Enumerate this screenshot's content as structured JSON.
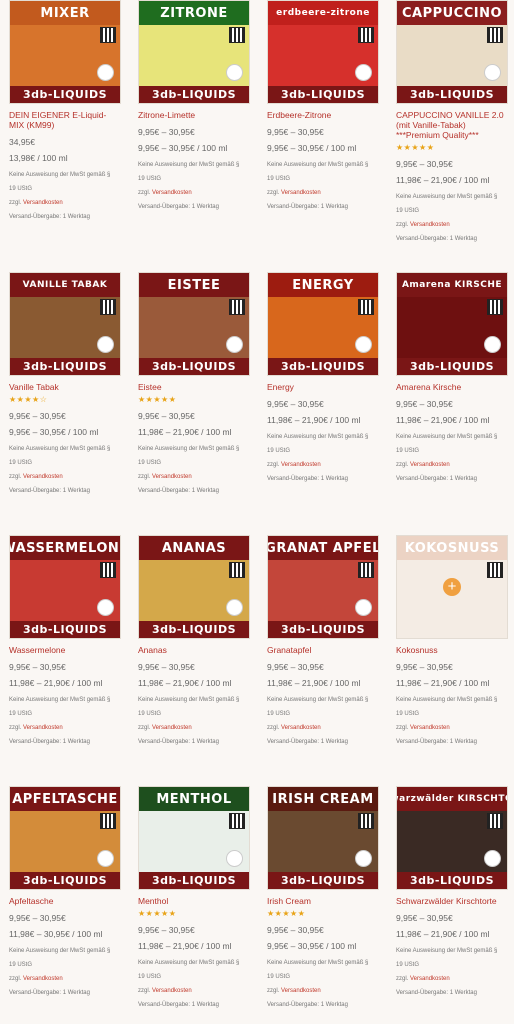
{
  "common": {
    "tax_line1": "Keine Ausweisung der MwSt gemäß §",
    "tax_line2": "19 UStG",
    "ship_prefix": "zzgl.",
    "ship_link": "Versandkosten",
    "handover": "Versand-Übergabe: 1 Werktag",
    "brand": "3db-LIQUIDS"
  },
  "colors": {
    "title": "#b5312a",
    "stars": "#e8a317",
    "brand_bar": "#7a1616"
  },
  "products": [
    {
      "title": "DEIN EIGENER E-Liquid-MIX (KM99)",
      "banner": "MIXER",
      "bg": "#d7742c",
      "banner_bg": "#c25a1e",
      "stars": "",
      "price": "34,95€",
      "unit": "13,98€ / 100 ml"
    },
    {
      "title": "Zitrone-Limette",
      "banner": "ZITRONE",
      "bg": "#e7e47a",
      "banner_bg": "#1f6d1f",
      "stars": "",
      "price": "9,95€ – 30,95€",
      "unit": "9,95€ – 30,95€ / 100 ml"
    },
    {
      "title": "Erdbeere-Zitrone",
      "banner": "erdbeere-zitrone",
      "bg": "#d6302c",
      "banner_bg": "#c0201c",
      "stars": "",
      "price": "9,95€ – 30,95€",
      "unit": "9,95€ – 30,95€ / 100 ml"
    },
    {
      "title": "CAPPUCCINO VANILLE 2.0 (mit Vanille-Tabak) ***Premium Quality***",
      "banner": "CAPPUCCINO",
      "bg": "#e9dcc6",
      "banner_bg": "#8b1e1e",
      "stars": "★★★★★",
      "price": "9,95€ – 30,95€",
      "unit": "11,98€ – 21,90€ / 100 ml"
    },
    {
      "title": "Vanille Tabak",
      "banner": "VANILLE TABAK",
      "bg": "#8a5a32",
      "banner_bg": "#7a1616",
      "stars": "★★★★☆",
      "price": "9,95€ – 30,95€",
      "unit": "9,95€ – 30,95€ / 100 ml"
    },
    {
      "title": "Eistee",
      "banner": "EISTEE",
      "bg": "#9a5a3a",
      "banner_bg": "#7a1616",
      "stars": "★★★★★",
      "price": "9,95€ – 30,95€",
      "unit": "11,98€ – 21,90€ / 100 ml"
    },
    {
      "title": "Energy",
      "banner": "ENERGY",
      "bg": "#d8671c",
      "banner_bg": "#9d1c10",
      "stars": "",
      "price": "9,95€ – 30,95€",
      "unit": "11,98€ – 21,90€ / 100 ml"
    },
    {
      "title": "Amarena Kirsche",
      "banner": "Amarena KIRSCHE",
      "bg": "#6e1010",
      "banner_bg": "#7a1616",
      "stars": "",
      "price": "9,95€ – 30,95€",
      "unit": "11,98€ – 21,90€ / 100 ml"
    },
    {
      "title": "Wassermelone",
      "banner": "WASSERMELONE",
      "bg": "#c83a32",
      "banner_bg": "#7a1616",
      "stars": "",
      "price": "9,95€ – 30,95€",
      "unit": "11,98€ – 21,90€ / 100 ml"
    },
    {
      "title": "Ananas",
      "banner": "ANANAS",
      "bg": "#d4a84a",
      "banner_bg": "#7a1616",
      "stars": "",
      "price": "9,95€ – 30,95€",
      "unit": "11,98€ – 21,90€ / 100 ml"
    },
    {
      "title": "Granatapfel",
      "banner": "GRANAT APFEL",
      "bg": "#c3463a",
      "banner_bg": "#7a1616",
      "stars": "",
      "price": "9,95€ – 30,95€",
      "unit": "11,98€ – 21,90€ / 100 ml"
    },
    {
      "title": "Kokosnuss",
      "banner": "KOKOSNUSS",
      "bg": "#f4ece4",
      "banner_bg": "#ecd3c4",
      "stars": "",
      "price": "9,95€ – 30,95€",
      "unit": "11,98€ – 21,90€ / 100 ml"
    },
    {
      "title": "Apfeltasche",
      "banner": "APFELTASCHE",
      "bg": "#d38c3a",
      "banner_bg": "#7a1616",
      "stars": "",
      "price": "9,95€ – 30,95€",
      "unit": "11,98€ – 30,95€ / 100 ml"
    },
    {
      "title": "Menthol",
      "banner": "MENTHOL",
      "bg": "#e9efe9",
      "banner_bg": "#1e4f1e",
      "stars": "★★★★★",
      "price": "9,95€ – 30,95€",
      "unit": "11,98€ – 21,90€ / 100 ml"
    },
    {
      "title": "Irish Cream",
      "banner": "IRISH CREAM",
      "bg": "#6a4a30",
      "banner_bg": "#5a1a10",
      "stars": "★★★★★",
      "price": "9,95€ – 30,95€",
      "unit": "9,95€ – 30,95€ / 100 ml"
    },
    {
      "title": "Schwarzwälder Kirschtorte",
      "banner": "Schwarzwälder KIRSCHTORTE",
      "bg": "#3a2a24",
      "banner_bg": "#7a1616",
      "stars": "",
      "price": "9,95€ – 30,95€",
      "unit": "11,98€ – 21,90€ / 100 ml"
    }
  ]
}
